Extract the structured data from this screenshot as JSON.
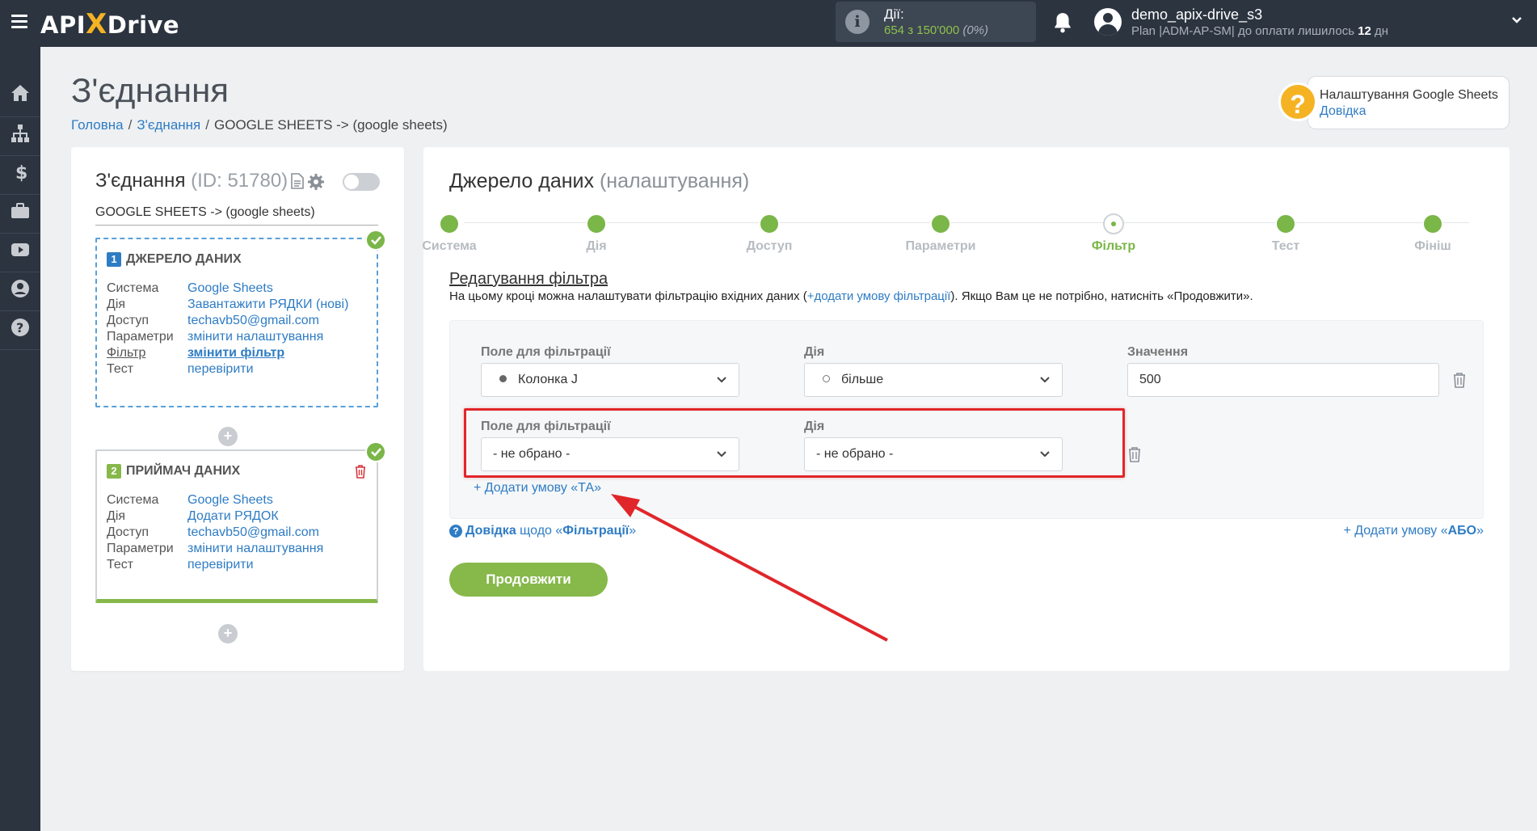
{
  "topbar": {
    "logo_left": "API",
    "logo_x": "X",
    "logo_right": "Drive",
    "actions_label": "Дії:",
    "actions_used": "654 з 150'000",
    "actions_pct": "(0%)",
    "user_name": "demo_apix-drive_s3",
    "plan_prefix": "Plan |ADM-AP-SM| до оплати лишилось ",
    "plan_days": "12",
    "plan_suffix": " дн"
  },
  "sidebar": {
    "icons": [
      "home-icon",
      "sitemap-icon",
      "dollar-icon",
      "briefcase-icon",
      "youtube-icon",
      "user-icon",
      "help-icon"
    ]
  },
  "header": {
    "title": "З'єднання",
    "breadcrumb": [
      "Головна",
      "З'єднання",
      "GOOGLE SHEETS -> (google sheets)"
    ]
  },
  "help": {
    "title": "Налаштування Google Sheets",
    "link": "Довідка"
  },
  "connection": {
    "title": "З'єднання",
    "id_label": "(ID: 51780)",
    "subtitle": "GOOGLE SHEETS -> (google sheets)",
    "source": {
      "num": "1",
      "header": "ДЖЕРЕЛО ДАНИХ",
      "rows": [
        {
          "k": "Система",
          "v": "Google Sheets"
        },
        {
          "k": "Дія",
          "v": "Завантажити РЯДКИ (нові)"
        },
        {
          "k": "Доступ",
          "v": "techavb50@gmail.com"
        },
        {
          "k": "Параметри",
          "v": "змінити налаштування"
        },
        {
          "k": "Фільтр",
          "v": "змінити фільтр"
        },
        {
          "k": "Тест",
          "v": "перевірити"
        }
      ]
    },
    "receiver": {
      "num": "2",
      "header": "ПРИЙМАЧ ДАНИХ",
      "rows": [
        {
          "k": "Система",
          "v": "Google Sheets"
        },
        {
          "k": "Дія",
          "v": "Додати РЯДОК"
        },
        {
          "k": "Доступ",
          "v": "techavb50@gmail.com"
        },
        {
          "k": "Параметри",
          "v": "змінити налаштування"
        },
        {
          "k": "Тест",
          "v": "перевірити"
        }
      ]
    }
  },
  "main": {
    "title": "Джерело даних",
    "title_light": "(налаштування)",
    "steps": [
      "Система",
      "Дія",
      "Доступ",
      "Параметри",
      "Фільтр",
      "Тест",
      "Фініш"
    ],
    "current_step": "Фільтр",
    "edit_title": "Редагування фільтра",
    "desc_before": "На цьому кроці можна налаштувати фільтрацію вхідних даних (",
    "desc_link": "+додати умову фільтрації",
    "desc_after": "). Якщо Вам це не потрібно, натисніть «Продовжити».",
    "row1": {
      "field_label": "Поле для фільтрації",
      "field_value": "Колонка J",
      "action_label": "Дія",
      "action_value": "більше",
      "value_label": "Значення",
      "value": "500"
    },
    "row2": {
      "field_label": "Поле для фільтрації",
      "field_value": "- не обрано -",
      "action_label": "Дія",
      "action_value": "- не обрано -"
    },
    "add_and": "+ Додати умову «ТА»",
    "help_prefix": "Довідка",
    "help_mid": " щодо «",
    "help_bold": "Фільтрації",
    "help_end": "»",
    "add_or_prefix": "+ Додати умову «",
    "add_or_bold": "АБО",
    "add_or_end": "»",
    "continue": "Продовжити"
  },
  "colors": {
    "accent": "#2e7cc4",
    "green": "#7ab648",
    "topbar": "#2c3440",
    "highlight": "#e0262a"
  }
}
